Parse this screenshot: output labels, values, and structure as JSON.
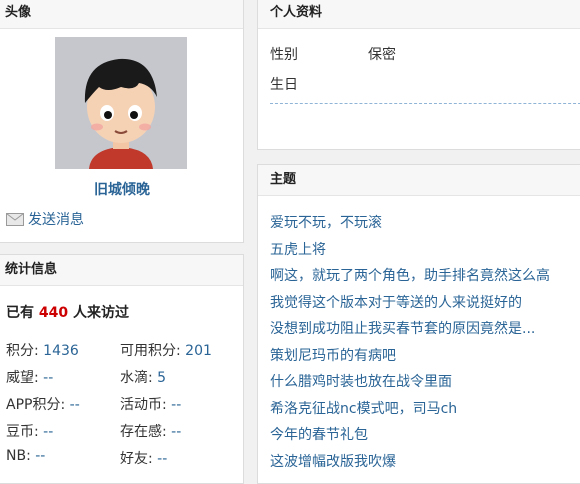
{
  "avatar_panel": {
    "title": "头像",
    "username": "旧城倾晚",
    "send_message": "发送消息"
  },
  "stats_panel": {
    "title": "统计信息",
    "visits_prefix": "已有",
    "visits_count": "440",
    "visits_suffix": "人来访过",
    "items": [
      {
        "label": "积分:",
        "value": "1436"
      },
      {
        "label": "可用积分:",
        "value": "201"
      },
      {
        "label": "威望:",
        "value": "--"
      },
      {
        "label": "水滴:",
        "value": "5"
      },
      {
        "label": "APP积分:",
        "value": "--"
      },
      {
        "label": "活动币:",
        "value": "--"
      },
      {
        "label": "豆币:",
        "value": "--"
      },
      {
        "label": "存在感:",
        "value": "--"
      },
      {
        "label": "NB:",
        "value": "--"
      },
      {
        "label": "好友:",
        "value": "--"
      }
    ]
  },
  "profile_panel": {
    "title": "个人资料",
    "rows": [
      {
        "label": "性别",
        "value": "保密"
      },
      {
        "label": "生日",
        "value": ""
      }
    ]
  },
  "topics_panel": {
    "title": "主题",
    "items": [
      "爱玩不玩，不玩滚",
      "五虎上将",
      "啊这，就玩了两个角色，助手排名竟然这么高",
      "我觉得这个版本对于等送的人来说挺好的",
      "没想到成功阻止我买春节套的原因竟然是...",
      "策划尼玛币的有病吧",
      "什么腊鸡时装也放在战令里面",
      "希洛克征战nc模式吧，司马ch",
      "今年的春节礼包",
      "这波增幅改版我吹爆"
    ]
  },
  "icons": {
    "mail": "envelope-icon"
  },
  "colors": {
    "link": "#2a6496",
    "accent_number": "#cc0000",
    "panel_header": "#f7f7f7"
  }
}
